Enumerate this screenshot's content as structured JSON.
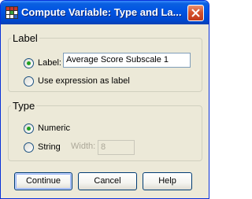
{
  "window": {
    "title": "Compute Variable: Type and La...",
    "icon": "spss-grid-icon",
    "close_icon": "close-icon"
  },
  "label_group": {
    "legend": "Label",
    "options": [
      {
        "label": "Label:",
        "checked": true
      },
      {
        "label": "Use expression as label",
        "checked": false
      }
    ],
    "label_value": "Average Score Subscale 1"
  },
  "type_group": {
    "legend": "Type",
    "options": [
      {
        "label": "Numeric",
        "checked": true
      },
      {
        "label": "String",
        "checked": false
      }
    ],
    "width_label": "Width:",
    "width_value": "8"
  },
  "buttons": {
    "continue": "Continue",
    "cancel": "Cancel",
    "help": "Help"
  },
  "colors": {
    "titlebar": "#0054e3",
    "dialog_bg": "#ece9d8",
    "radio_dot": "#21a121",
    "close_button": "#d5532e"
  }
}
